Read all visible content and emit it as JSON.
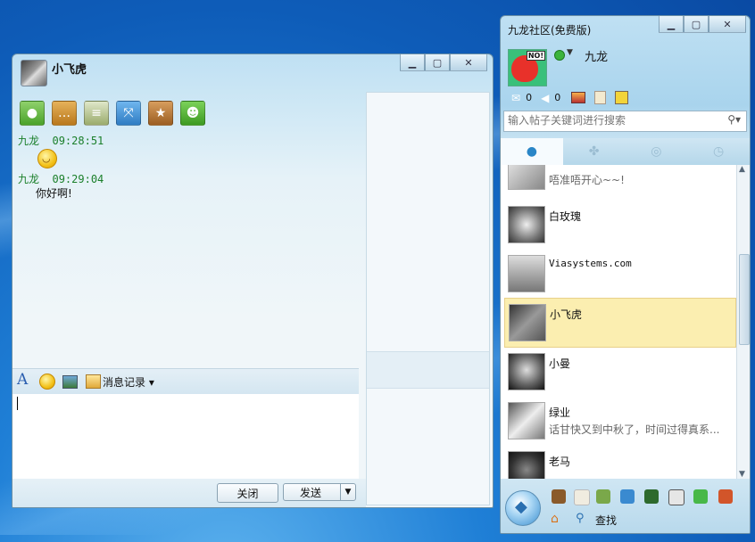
{
  "chat": {
    "title": "小飞虎",
    "messages": [
      {
        "sender": "九龙",
        "time": "09:28:51",
        "content": ""
      },
      {
        "sender": "九龙",
        "time": "09:29:04",
        "content": "你好啊!"
      }
    ],
    "history_label": "消息记录",
    "close_label": "关闭",
    "send_label": "发送"
  },
  "main": {
    "title": "九龙社区(免费版)",
    "nickname": "九龙",
    "mail_count": "0",
    "sound_count": "0",
    "avatar_tag": "NO!",
    "search_placeholder": "输入帖子关键词进行搜索",
    "contacts": [
      {
        "name": "",
        "status": "唔准唔开心~~!"
      },
      {
        "name": "白玫瑰",
        "status": ""
      },
      {
        "name": "Viasystems.com",
        "status": ""
      },
      {
        "name": "小飞虎",
        "status": ""
      },
      {
        "name": "小曼",
        "status": ""
      },
      {
        "name": "绿业",
        "status": "话甘快又到中秋了，时间过得真系..."
      },
      {
        "name": "老马",
        "status": ""
      }
    ],
    "find_label": "查找"
  }
}
